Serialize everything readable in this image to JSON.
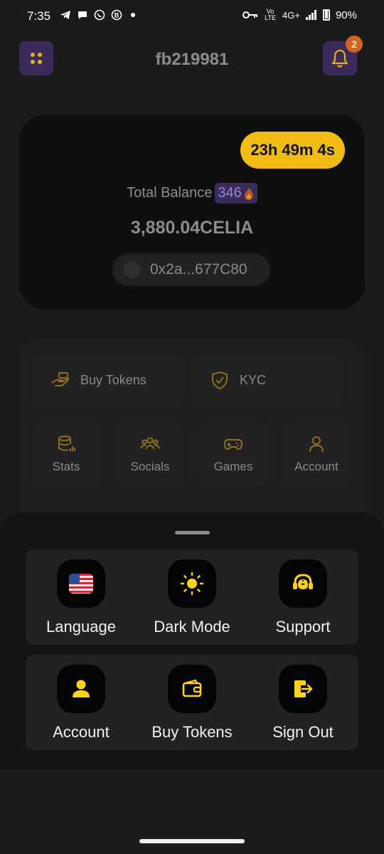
{
  "status_bar": {
    "time": "7:35",
    "network_volte": "Vo LTE",
    "network_type": "4G+",
    "battery": "90%"
  },
  "header": {
    "username": "fb219981",
    "notification_count": "2"
  },
  "balance": {
    "timer": "23h 49m 4s",
    "label": "Total Balance",
    "streak": "346",
    "amount": "3,880.04CELIA",
    "wallet_address": "0x2a...677C80"
  },
  "quick_menu": {
    "buy_tokens": "Buy Tokens",
    "kyc": "KYC",
    "stats": "Stats",
    "socials": "Socials",
    "games": "Games",
    "account": "Account"
  },
  "sheet": {
    "language": "Language",
    "dark_mode": "Dark Mode",
    "support": "Support",
    "account": "Account",
    "buy_tokens": "Buy Tokens",
    "sign_out": "Sign Out"
  },
  "colors": {
    "accent_yellow": "#f2bb14",
    "purple": "#3b2a5a",
    "background": "#1b1b1b"
  }
}
